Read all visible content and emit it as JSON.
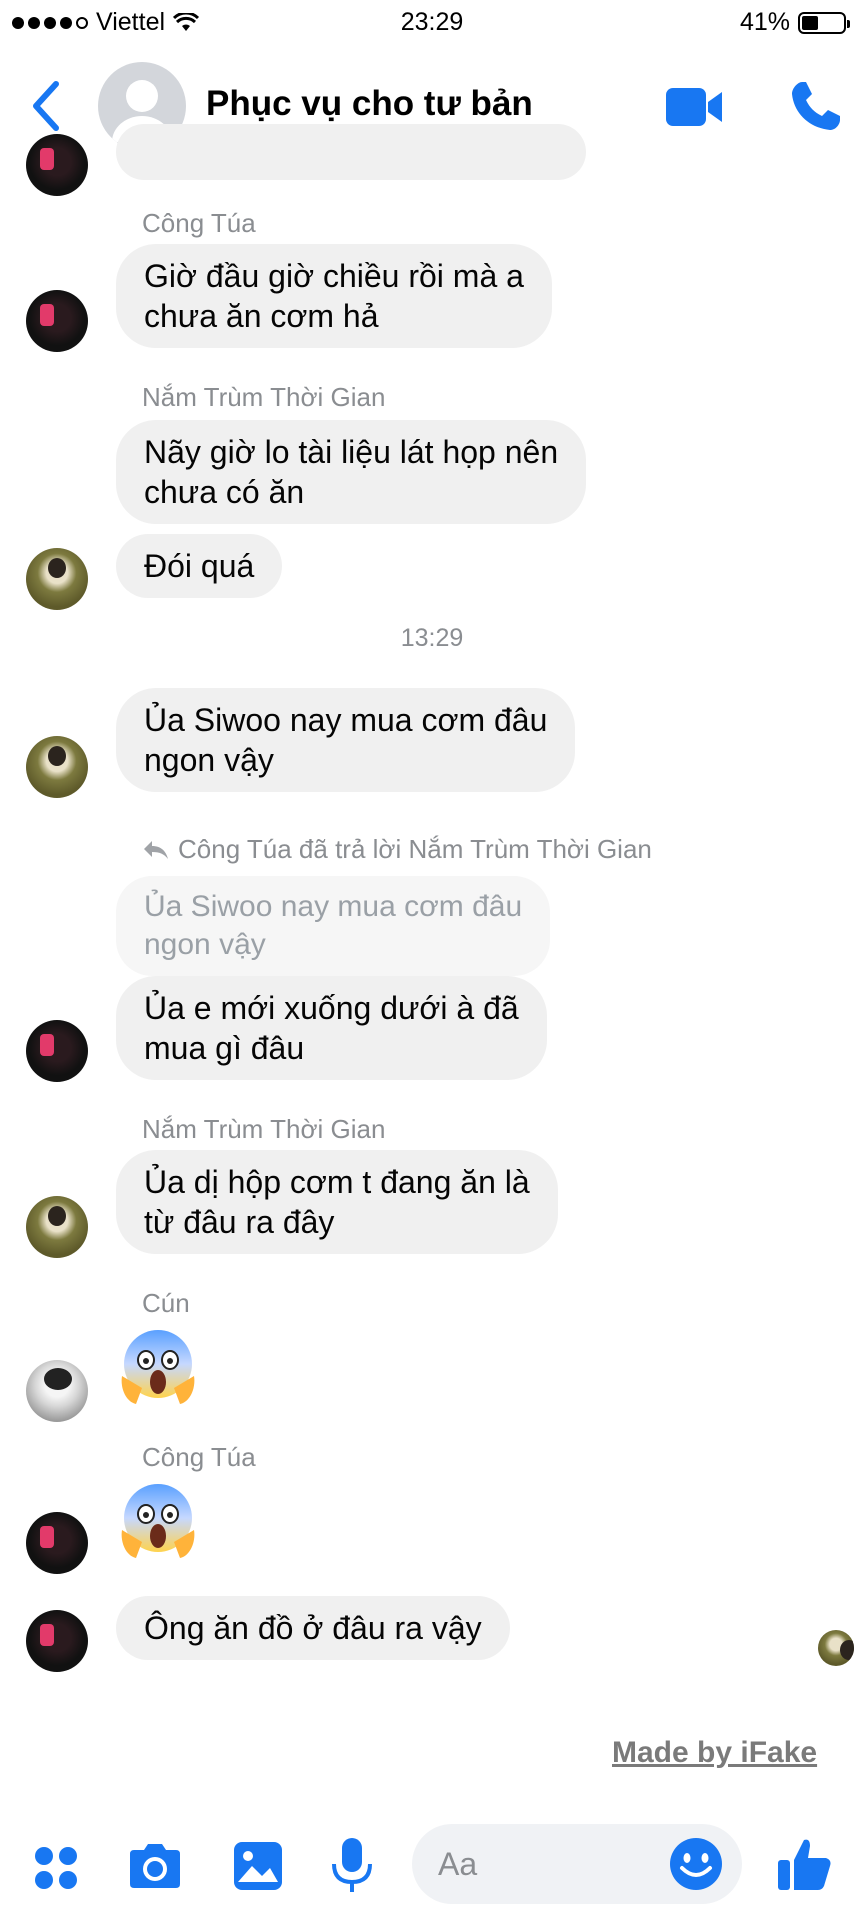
{
  "status_bar": {
    "carrier": "Viettel",
    "time": "23:29",
    "battery": "41%",
    "battery_level": 0.41
  },
  "header": {
    "title": "Phục vụ cho tư bản",
    "icons": [
      "back-icon",
      "video-call-icon",
      "phone-icon"
    ],
    "accent": "#1877f2"
  },
  "messages": [
    {
      "sender": "Công Túa",
      "lines": [
        "Giờ đầu giờ chiều rồi mà a",
        "chưa ăn cơm hả"
      ]
    },
    {
      "sender": "Nắm Trùm Thời Gian",
      "lines": [
        "Nãy giờ lo tài liệu lát họp nên",
        "chưa có ăn"
      ]
    },
    {
      "sender": "",
      "lines": [
        "Đói quá"
      ]
    },
    {
      "timestamp": "13:29"
    },
    {
      "sender": "",
      "lines": [
        "Ủa Siwoo nay mua cơm đâu",
        "ngon vậy"
      ]
    },
    {
      "reply_header": "Công Túa đã trả lời Nắm Trùm Thời Gian",
      "quoted": [
        "Ủa Siwoo nay mua cơm đâu",
        "ngon vậy"
      ],
      "lines": [
        "Ủa e mới xuống dưới à đã",
        "mua gì đâu"
      ]
    },
    {
      "sender": "Nắm Trùm Thời Gian",
      "lines": [
        "Ủa dị hộp cơm t đang ăn là",
        "từ đâu ra đây"
      ]
    },
    {
      "sender": "Cún",
      "emoji": "scream-emoji"
    },
    {
      "sender": "Công Túa",
      "emoji": "scream-emoji"
    },
    {
      "sender": "",
      "lines": [
        "Ông ăn đồ ở đâu ra vậy"
      ]
    }
  ],
  "watermark": "Made by iFake",
  "composer": {
    "placeholder": "Aa",
    "icons": [
      "apps-icon",
      "camera-icon",
      "gallery-icon",
      "microphone-icon",
      "emoji-icon",
      "like-icon"
    ]
  }
}
